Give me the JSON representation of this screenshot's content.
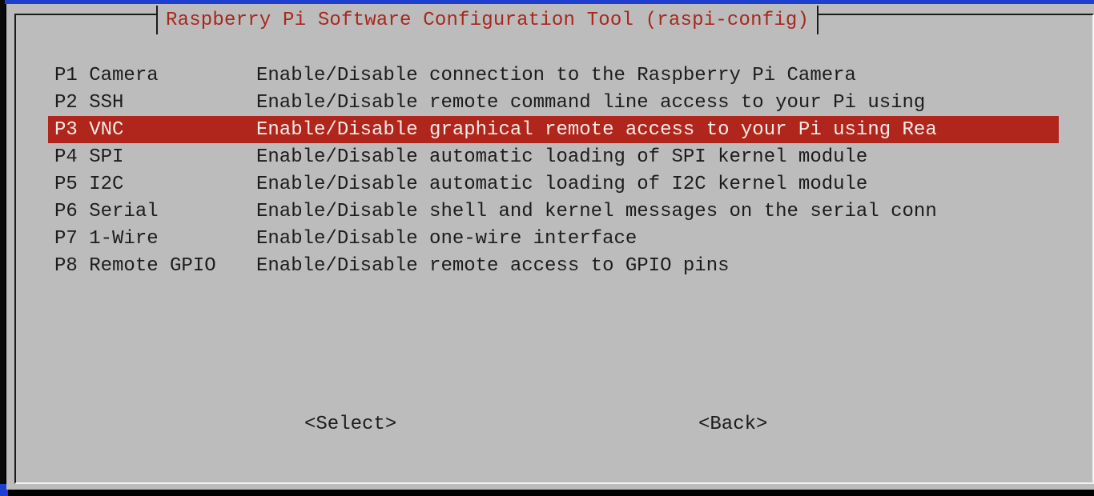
{
  "dialog": {
    "title": "Raspberry Pi Software Configuration Tool (raspi-config)"
  },
  "menu": {
    "items": [
      {
        "key": "P1 Camera",
        "description": "Enable/Disable connection to the Raspberry Pi Camera",
        "selected": false
      },
      {
        "key": "P2 SSH",
        "description": "Enable/Disable remote command line access to your Pi using",
        "selected": false
      },
      {
        "key": "P3 VNC",
        "description": "Enable/Disable graphical remote access to your Pi using Rea",
        "selected": true
      },
      {
        "key": "P4 SPI",
        "description": "Enable/Disable automatic loading of SPI kernel module",
        "selected": false
      },
      {
        "key": "P5 I2C",
        "description": "Enable/Disable automatic loading of I2C kernel module",
        "selected": false
      },
      {
        "key": "P6 Serial",
        "description": "Enable/Disable shell and kernel messages on the serial conn",
        "selected": false
      },
      {
        "key": "P7 1-Wire",
        "description": "Enable/Disable one-wire interface",
        "selected": false
      },
      {
        "key": "P8 Remote GPIO",
        "description": "Enable/Disable remote access to GPIO pins",
        "selected": false
      }
    ]
  },
  "buttons": {
    "select_label": "<Select>",
    "back_label": "<Back>"
  },
  "colors": {
    "dialog_background": "#bcbcbc",
    "title_text": "#a8271d",
    "selection_background": "#b0261c",
    "selection_text": "#f4ece7",
    "top_strip": "#1f3fd0"
  }
}
